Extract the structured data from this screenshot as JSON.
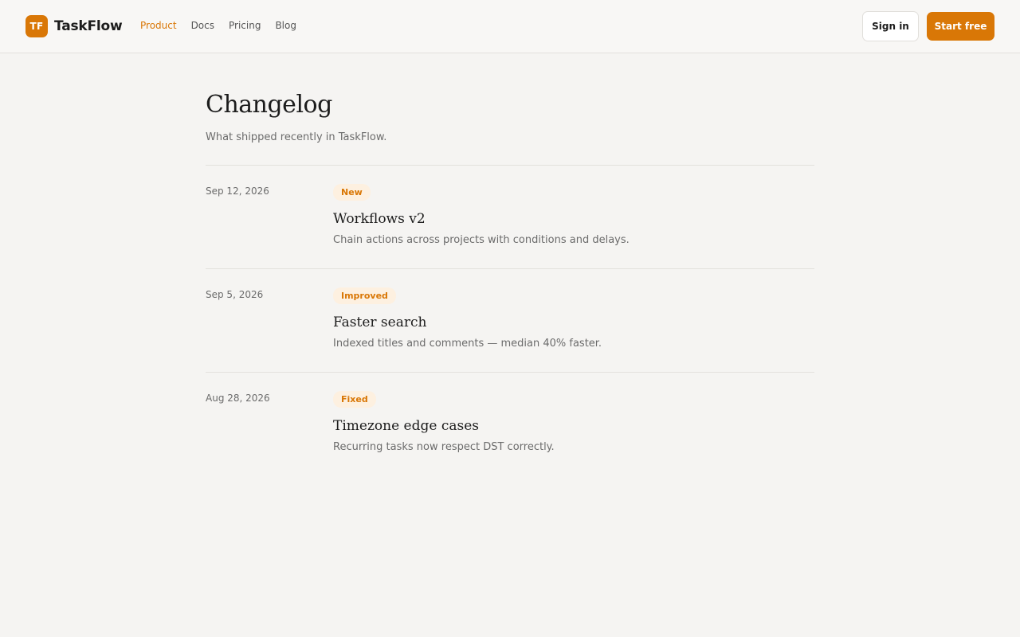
{
  "brand": {
    "mark": "TF",
    "name": "TaskFlow",
    "accent_color": "#d97706"
  },
  "nav": {
    "items": [
      {
        "label": "Product",
        "active": true
      },
      {
        "label": "Docs",
        "active": false
      },
      {
        "label": "Pricing",
        "active": false
      },
      {
        "label": "Blog",
        "active": false
      }
    ]
  },
  "header_actions": {
    "signin_label": "Sign in",
    "start_label": "Start free"
  },
  "page": {
    "title": "Changelog",
    "subtitle": "What shipped recently in TaskFlow."
  },
  "entries": [
    {
      "date": "Sep 12, 2026",
      "badge": "New",
      "title": "Workflows v2",
      "description": "Chain actions across projects with conditions and delays."
    },
    {
      "date": "Sep 5, 2026",
      "badge": "Improved",
      "title": "Faster search",
      "description": "Indexed titles and comments — median 40% faster."
    },
    {
      "date": "Aug 28, 2026",
      "badge": "Fixed",
      "title": "Timezone edge cases",
      "description": "Recurring tasks now respect DST correctly."
    }
  ]
}
